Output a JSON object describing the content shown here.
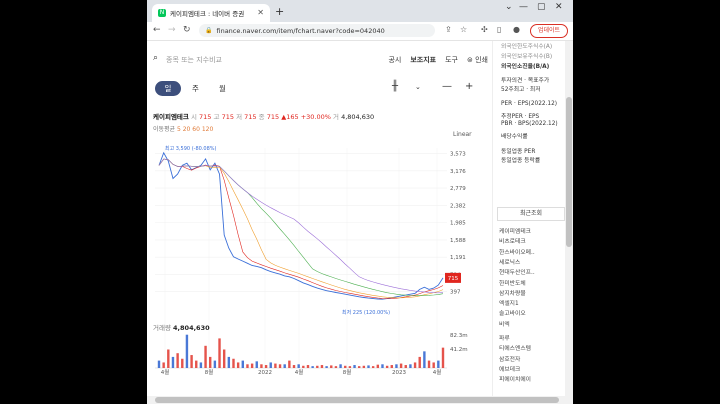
{
  "browser": {
    "tab_title": "케이피엠테크 : 네이버 증권",
    "url": "finance.naver.com/item/fchart.naver?code=042040",
    "update_label": "업데이트"
  },
  "search": {
    "placeholder": "종목 또는 지수비교"
  },
  "toplinks": [
    "공시",
    "보조지표",
    "도구",
    "인쇄"
  ],
  "periods": [
    "일",
    "주",
    "월"
  ],
  "stock": {
    "name": "케이피엠테크",
    "open_label": "시",
    "open": "715",
    "high_label": "고",
    "high": "715",
    "low_label": "저",
    "low": "715",
    "close_label": "종",
    "close": "715",
    "change": "▲165 +30.00%",
    "volume_label": "거",
    "volume": "4,804,630"
  },
  "ma": {
    "label": "이동평균",
    "periods": "5 20 60 120"
  },
  "scale_mode": "Linear",
  "volume": {
    "label": "거래량",
    "value": "4,804,630"
  },
  "chart_data": {
    "type": "line",
    "x_ticks": [
      "4월",
      "8월",
      "2022",
      "4월",
      "8월",
      "2023",
      "4월"
    ],
    "y_ticks": [
      "3,573",
      "3,176",
      "2,779",
      "2,382",
      "1,985",
      "1,588",
      "1,191",
      "794",
      "397"
    ],
    "y_range": [
      0,
      3700
    ],
    "current_price": "715",
    "max_annotation": "최고 3,590 (-80.08%)",
    "min_annotation": "최저 225 (120.00%)",
    "price_series": [
      3300,
      3590,
      3400,
      3000,
      3100,
      3300,
      3350,
      3200,
      3250,
      3300,
      3450,
      3200,
      3350,
      3100,
      1700,
      1400,
      1200,
      1150,
      1100,
      1050,
      1000,
      980,
      950,
      900,
      860,
      830,
      800,
      760,
      740,
      700,
      650,
      600,
      560,
      520,
      480,
      450,
      420,
      400,
      380,
      360,
      340,
      320,
      300,
      280,
      265,
      250,
      240,
      230,
      225,
      240,
      260,
      280,
      300,
      320,
      340,
      360,
      450,
      500,
      450,
      480,
      550,
      715
    ],
    "volume_y_ticks": [
      "82.3m",
      "41.2m"
    ]
  },
  "sidebar": {
    "top_items": [
      "외국인한도주식수(A)",
      "외국인보유주식수(B)",
      "외국인소진율(B/A)"
    ],
    "mid_items": [
      "투자의견 · 목표주가",
      "52주최고 · 최저"
    ],
    "per_items": [
      "PER · EPS(2022.12)",
      "추정PER · EPS",
      "PBR · BPS(2022.12)",
      "배당수익률"
    ],
    "sector_items": [
      "동일업종 PER",
      "동일업종 등락률"
    ],
    "recent_header": "최근조회",
    "recent": [
      "케이피엠테크",
      "비츠로테크",
      "한스바이오메..",
      "세로닉스",
      "현대두산인프..",
      "한미반도체",
      "삼지차량물",
      "엑셀지1",
      "솔고바이오",
      "비엑",
      "파루",
      "티에스엔스템",
      "삼호전자",
      "에브데크",
      "피에이치에이"
    ]
  }
}
